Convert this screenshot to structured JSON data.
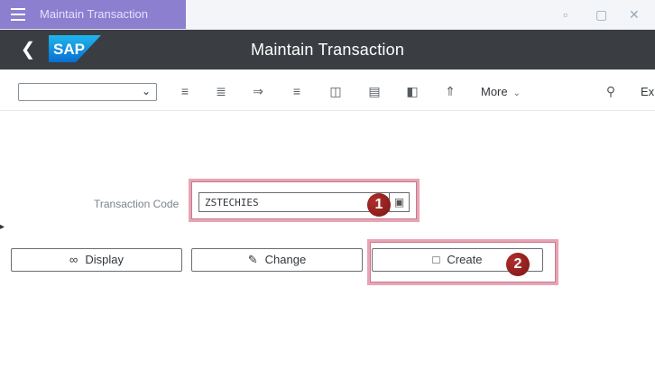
{
  "window": {
    "title": "Maintain Transaction",
    "menu_icon": "hamburger-menu-icon",
    "controls": [
      "minimize-icon",
      "maximize-icon",
      "close-icon"
    ]
  },
  "shell": {
    "logo": "SAP",
    "title": "Maintain Transaction",
    "back_icon": "chevron-left-icon"
  },
  "toolbar": {
    "variant_value": "",
    "icons": [
      "toolbar-icon-1",
      "toolbar-icon-2",
      "toolbar-icon-3",
      "toolbar-icon-4",
      "toolbar-icon-5",
      "toolbar-icon-6",
      "toolbar-icon-7",
      "toolbar-icon-8"
    ],
    "more_label": "More",
    "exit_label": "Ex"
  },
  "form": {
    "tcode_label": "Transaction Code",
    "tcode_value": "ZSTECHIES"
  },
  "actions": {
    "display_label": "Display",
    "change_label": "Change",
    "create_label": "Create"
  },
  "annotations": {
    "marker1": "1",
    "marker2": "2"
  },
  "colors": {
    "shellbar": "#3a3d42",
    "title_box": "#8c7fd0",
    "highlight": "#e8a4b4",
    "marker": "#9e2220"
  }
}
